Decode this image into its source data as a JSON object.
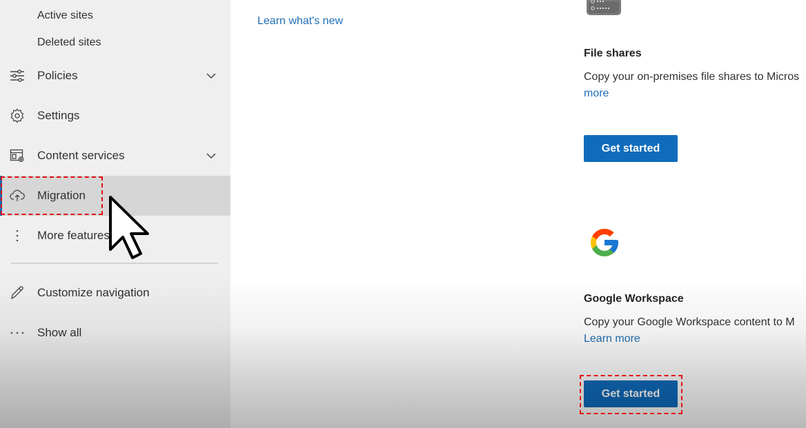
{
  "sidebar": {
    "sub_items": [
      {
        "label": "Active sites"
      },
      {
        "label": "Deleted sites"
      }
    ],
    "items": [
      {
        "label": "Policies",
        "icon": "sliders-icon",
        "expandable": true
      },
      {
        "label": "Settings",
        "icon": "gear-icon",
        "expandable": false
      },
      {
        "label": "Content services",
        "icon": "content-services-icon",
        "expandable": true
      },
      {
        "label": "Migration",
        "icon": "cloud-upload-icon",
        "expandable": false,
        "selected": true
      },
      {
        "label": "More features",
        "icon": "more-vertical-icon",
        "expandable": false
      }
    ],
    "footer_items": [
      {
        "label": "Customize navigation",
        "icon": "pencil-icon"
      },
      {
        "label": "Show all",
        "icon": "more-horizontal-icon"
      }
    ]
  },
  "main": {
    "learn_whats_new": "Learn what's new",
    "cards": [
      {
        "title": "File shares",
        "description": "Copy your on-premises file shares to Micros",
        "learn_more": "more",
        "button": "Get started",
        "icon": "file-server-icon"
      },
      {
        "title": "Google Workspace",
        "description": "Copy your Google Workspace content to M",
        "learn_more": "Learn more",
        "button": "Get started",
        "icon": "google-logo-icon"
      }
    ]
  },
  "colors": {
    "accent": "#0f6cbd",
    "link": "#1f6fb5",
    "highlight": "#e30d0d",
    "sidebar_bg": "#efefef",
    "selected_bg": "#d6d6d6"
  }
}
